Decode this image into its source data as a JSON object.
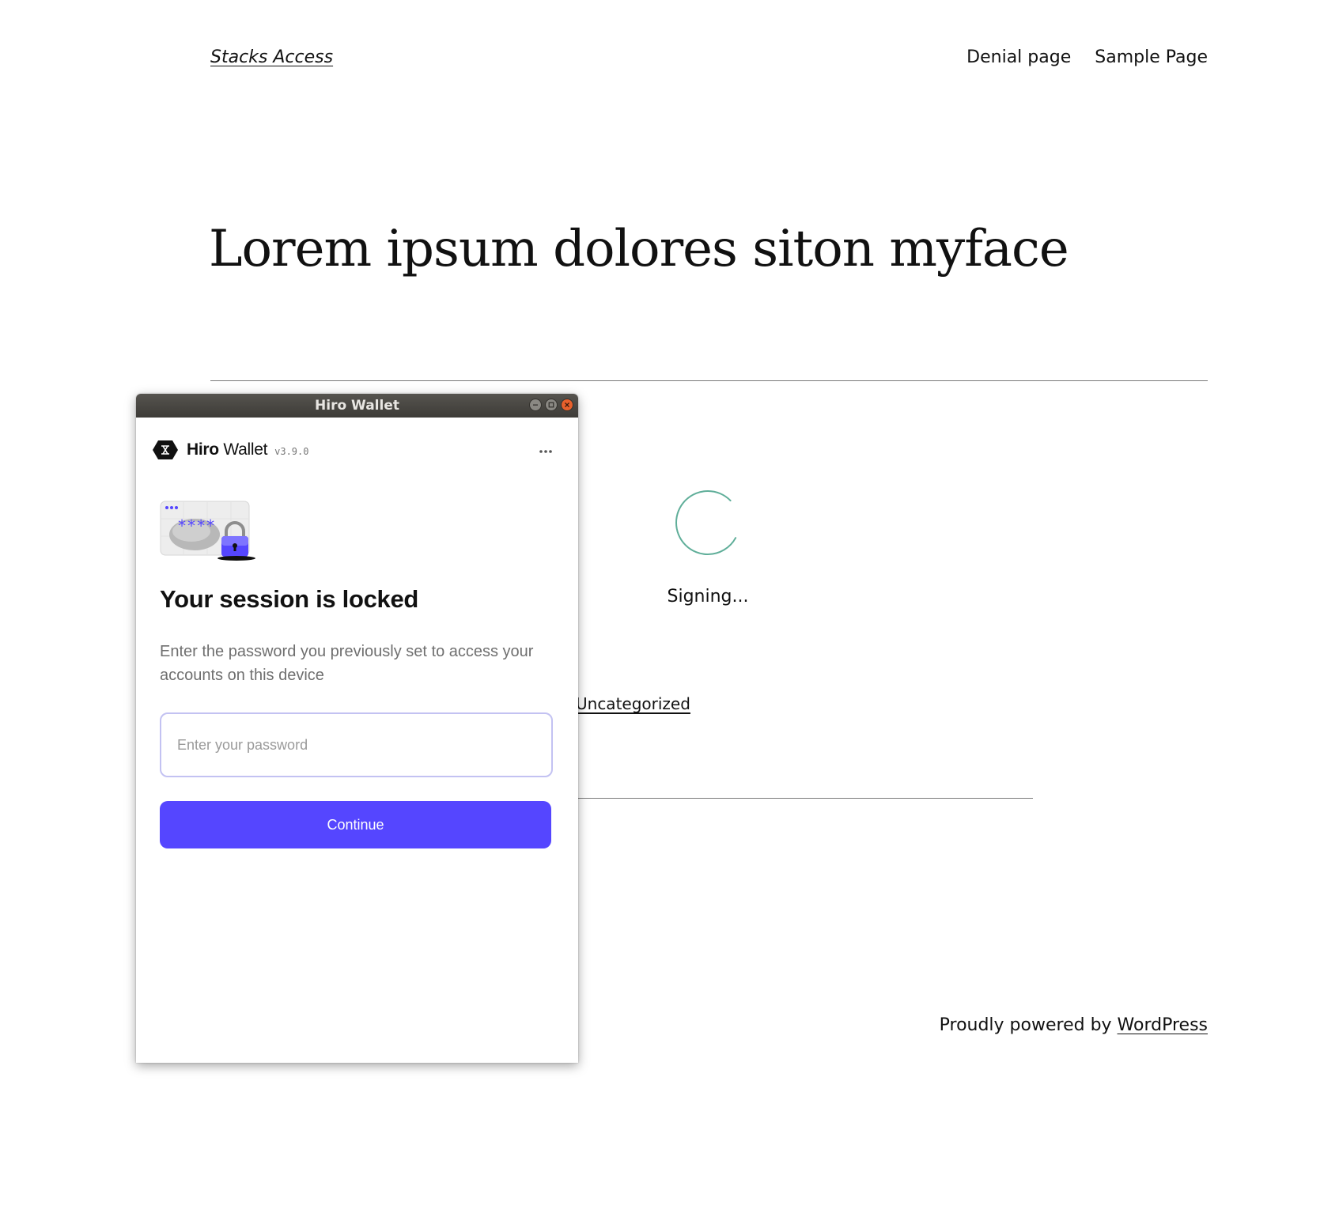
{
  "site": {
    "title": "Stacks Access",
    "nav": [
      "Denial page",
      "Sample Page"
    ]
  },
  "post": {
    "title": "Lorem ipsum dolores siton myface",
    "signing_text": "Signing...",
    "category": "Uncategorized"
  },
  "footer": {
    "prefix": "Proudly powered by ",
    "link": "WordPress"
  },
  "wallet_window": {
    "title": "Hiro Wallet",
    "brand_bold": "Hiro",
    "brand_light": "Wallet",
    "version": "v3.9.0",
    "menu_icon": "more-horizontal-icon",
    "heading": "Your session is locked",
    "description": "Enter the password you previously set to access your accounts on this device",
    "password_placeholder": "Enter your password",
    "password_value": "",
    "continue_label": "Continue",
    "accent_color": "#5546ff",
    "spinner_color": "#5fae99"
  }
}
